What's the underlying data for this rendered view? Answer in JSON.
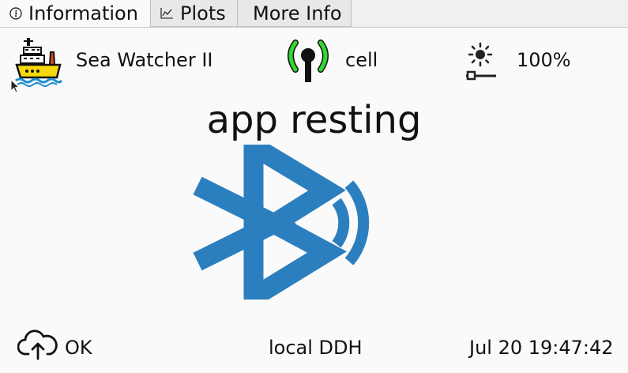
{
  "tabs": [
    {
      "label": "Information",
      "icon": "info-icon",
      "active": true
    },
    {
      "label": "Plots",
      "icon": "chart-icon",
      "active": false
    },
    {
      "label": "More Info",
      "icon": "",
      "active": false
    }
  ],
  "header": {
    "vessel_name": "Sea Watcher II",
    "vessel_icon": "boat-icon",
    "connection": "cell",
    "connection_icon": "antenna-icon",
    "brightness": "100%",
    "brightness_icon": "brightness-icon"
  },
  "status": {
    "title": "app resting",
    "icon": "bluetooth-icon",
    "icon_color": "#2b7fbf"
  },
  "footer": {
    "cloud_status": "OK",
    "cloud_icon": "cloud-upload-icon",
    "ddh_label": "local DDH",
    "datetime": "Jul 20 19:47:42"
  },
  "colors": {
    "antenna_green": "#33d633",
    "boat_yellow": "#f5d90a",
    "boat_red": "#e04a2a"
  }
}
